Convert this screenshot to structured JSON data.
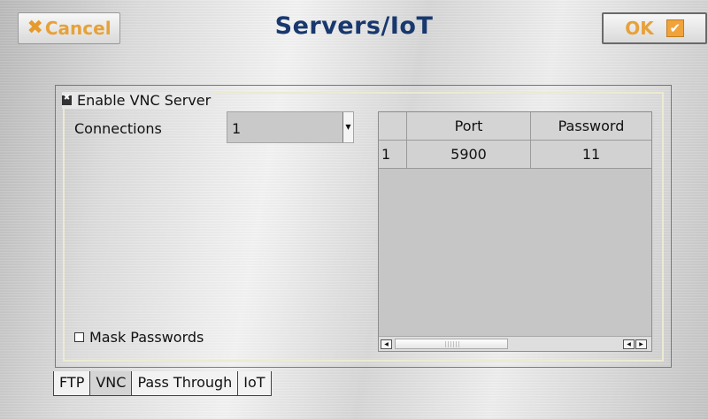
{
  "header": {
    "title": "Servers/IoT",
    "cancel_label": "Cancel",
    "ok_label": "OK"
  },
  "vnc": {
    "enable_label": "Enable VNC Server",
    "enable_checked": true,
    "connections_label": "Connections",
    "connections_value": "1",
    "mask_label": "Mask Passwords",
    "mask_checked": false
  },
  "table": {
    "columns": [
      "",
      "Port",
      "Password"
    ],
    "rows": [
      [
        "1",
        "5900",
        "11"
      ]
    ]
  },
  "tabs": [
    {
      "label": "FTP",
      "active": false
    },
    {
      "label": "VNC",
      "active": true
    },
    {
      "label": "Pass Through",
      "active": false
    },
    {
      "label": "IoT",
      "active": false
    }
  ],
  "colors": {
    "title": "#18386e",
    "button_accent": "#e7a13a"
  },
  "icons": {
    "cancel": "x-icon",
    "ok": "check-icon",
    "scroll_left": "arrow-left-icon",
    "scroll_right": "arrow-right-icon",
    "dropdown": "chevron-down-icon"
  }
}
